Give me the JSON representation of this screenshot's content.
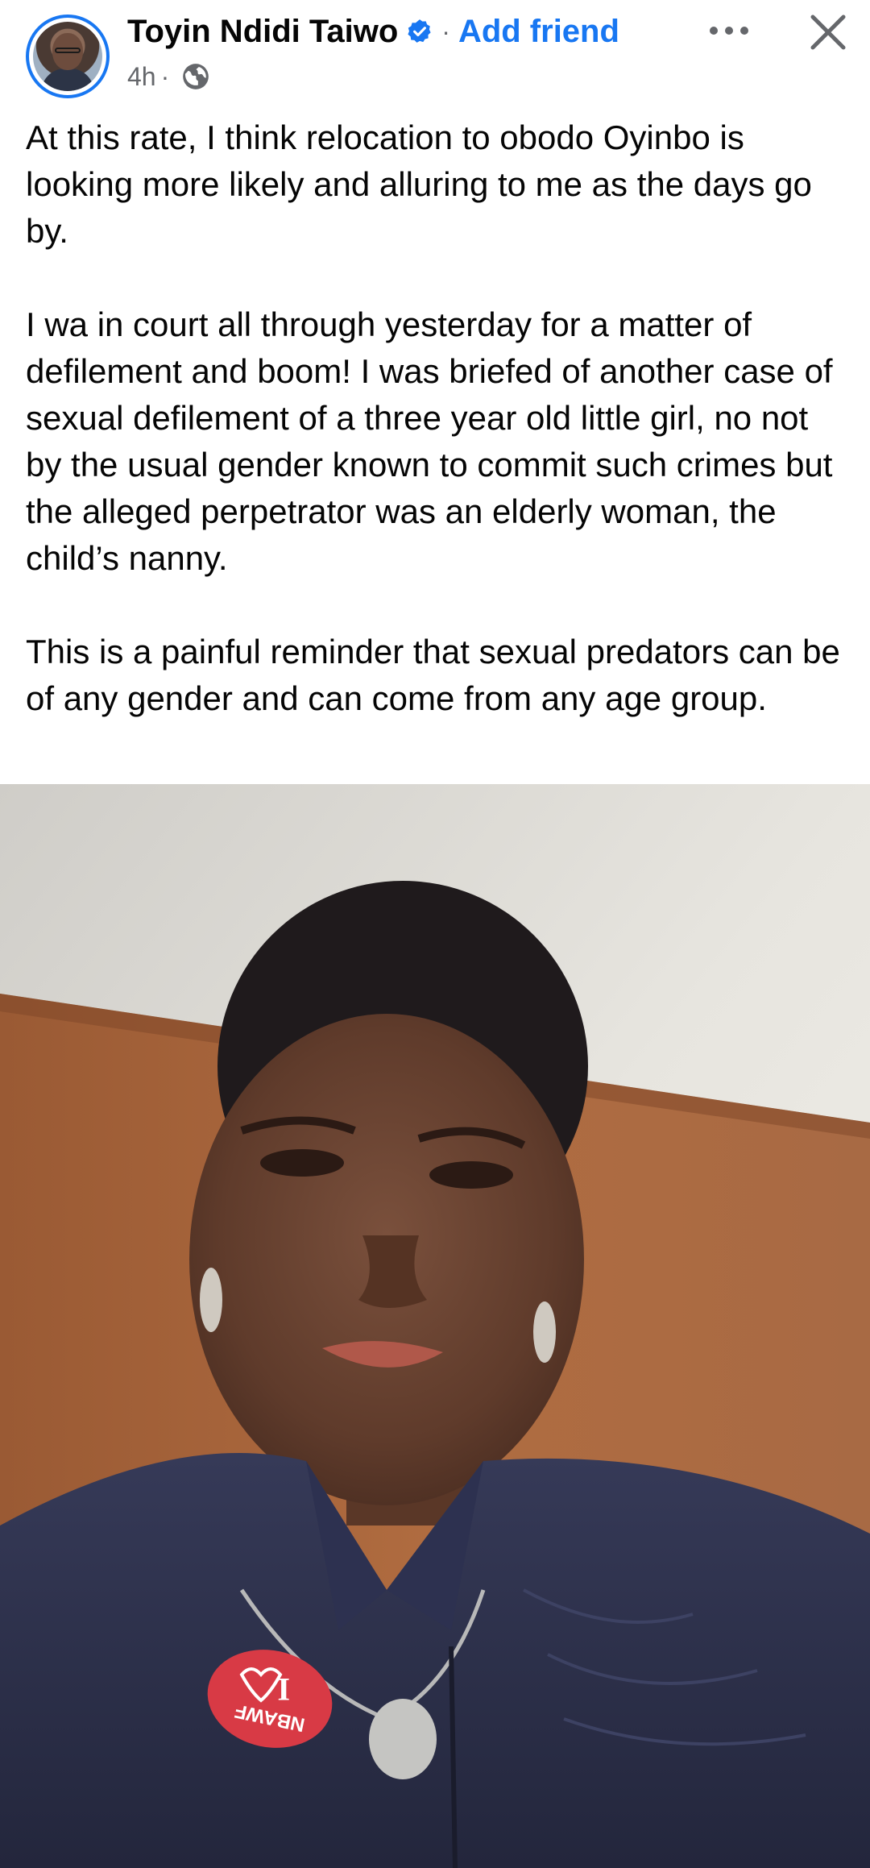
{
  "header": {
    "author_name": "Toyin Ndidi Taiwo",
    "separator": "·",
    "add_friend_label": "Add friend",
    "timestamp": "4h",
    "timestamp_separator": "·",
    "privacy_icon": "globe-icon",
    "verified_icon": "verified-badge-icon",
    "more_icon": "more-options-icon",
    "close_icon": "close-icon"
  },
  "post": {
    "paragraphs": [
      "At this rate, I think relocation to obodo Oyinbo is looking more likely and alluring to me as the days go by.",
      "I wa in court all through yesterday for a matter of defilement and boom! I was briefed of another case of sexual defilement of a three year old little girl, no not by the usual gender known to commit such crimes but the alleged perpetrator was an elderly woman, the child’s nanny.",
      "This is a painful reminder that sexual predators can be of any gender and can come from any age group."
    ]
  },
  "photo": {
    "badge_text_top": "I",
    "badge_text_bottom": "NBAWF"
  },
  "colors": {
    "accent": "#1877f2",
    "secondary_text": "#65676b",
    "primary_text": "#050505"
  }
}
